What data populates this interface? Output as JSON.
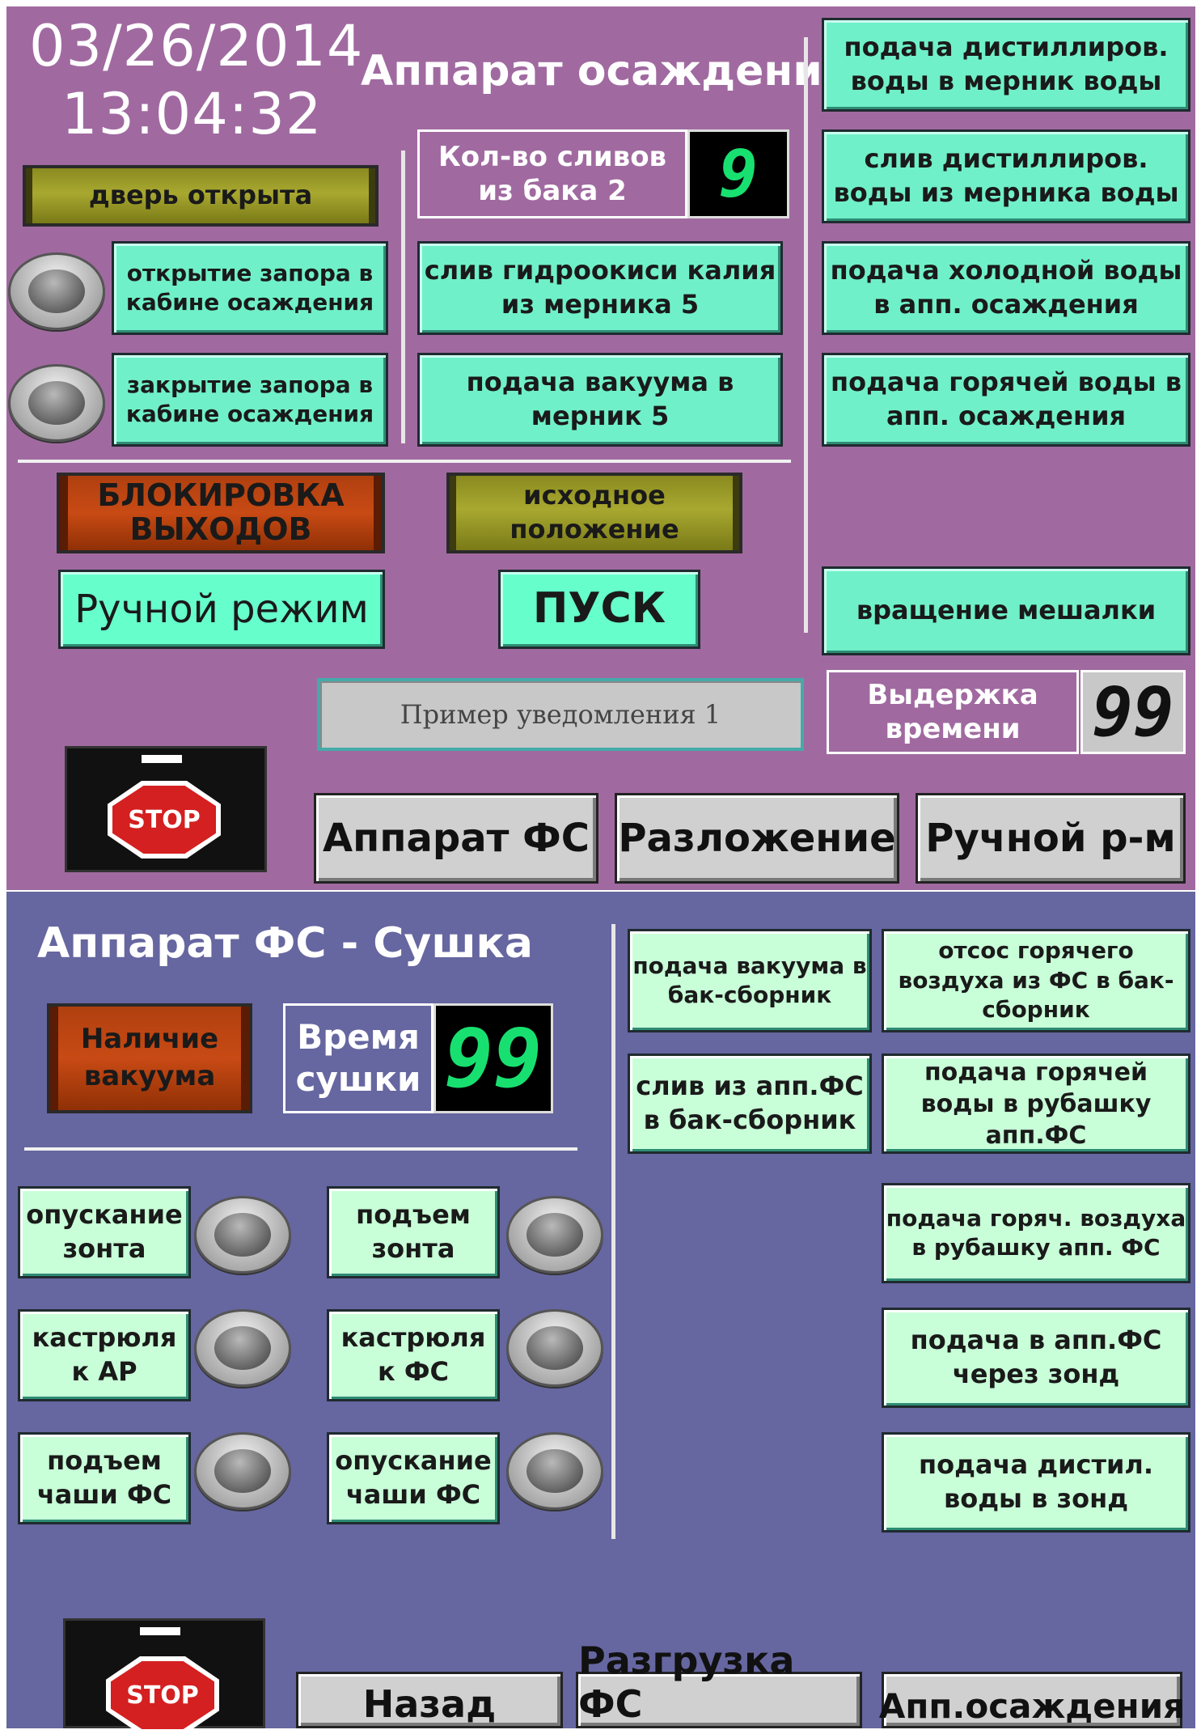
{
  "top": {
    "date": "03/26/2014",
    "time": "13:04:32",
    "title": "Аппарат осаждения",
    "door_lamp": "дверь открыта",
    "open_lock": "открытие запора в кабине осаждения",
    "close_lock": "закрытие запора в кабине осаждения",
    "drains_label": "Кол-во сливов из бака 2",
    "drains_value": "9",
    "koh_drain": "слив гидроокиси калия из мерника 5",
    "vacuum_feed": "подача вакуума в мерник 5",
    "block_outputs": "БЛОКИРОВКА ВЫХОДОВ",
    "initial_position": "исходное положение",
    "manual_mode": "Ручной режим",
    "start": "ПУСК",
    "notification": "Пример уведомления 1",
    "right_buttons": [
      "подача дистиллиров. воды в мерник воды",
      "слив дистиллиров. воды из мерника воды",
      "подача холодной воды в апп. осаждения",
      "подача горячей воды в апп. осаждения"
    ],
    "stirrer": "вращение мешалки",
    "hold_label": "Выдержка времени",
    "hold_value": "99",
    "stop_label": "STOP",
    "nav": [
      "Аппарат ФС",
      "Разложение",
      "Ручной р-м"
    ]
  },
  "bottom": {
    "title": "Аппарат ФС - Сушка",
    "vacuum_lamp": "Наличие вакуума",
    "dry_label": "Время сушки",
    "dry_value": "99",
    "left_buttons": [
      "опускание зонта",
      "подъем зонта",
      "кастрюля к АР",
      "кастрюля к ФС",
      "подъем чаши ФС",
      "опускание чаши ФС"
    ],
    "right_buttons": [
      "подача вакуума в бак-сборник",
      "отсос горячего воздуха из ФС в бак-сборник",
      "слив из апп.ФС в бак-сборник",
      "подача горячей воды в рубашку апп.ФС",
      "подача горяч. воздуха в рубашку апп. ФС",
      "подача в апп.ФС через зонд",
      "подача дистил. воды в зонд"
    ],
    "stop_label": "STOP",
    "nav": [
      "Назад",
      "Разгрузка ФС",
      "Апп.осаждения"
    ]
  }
}
